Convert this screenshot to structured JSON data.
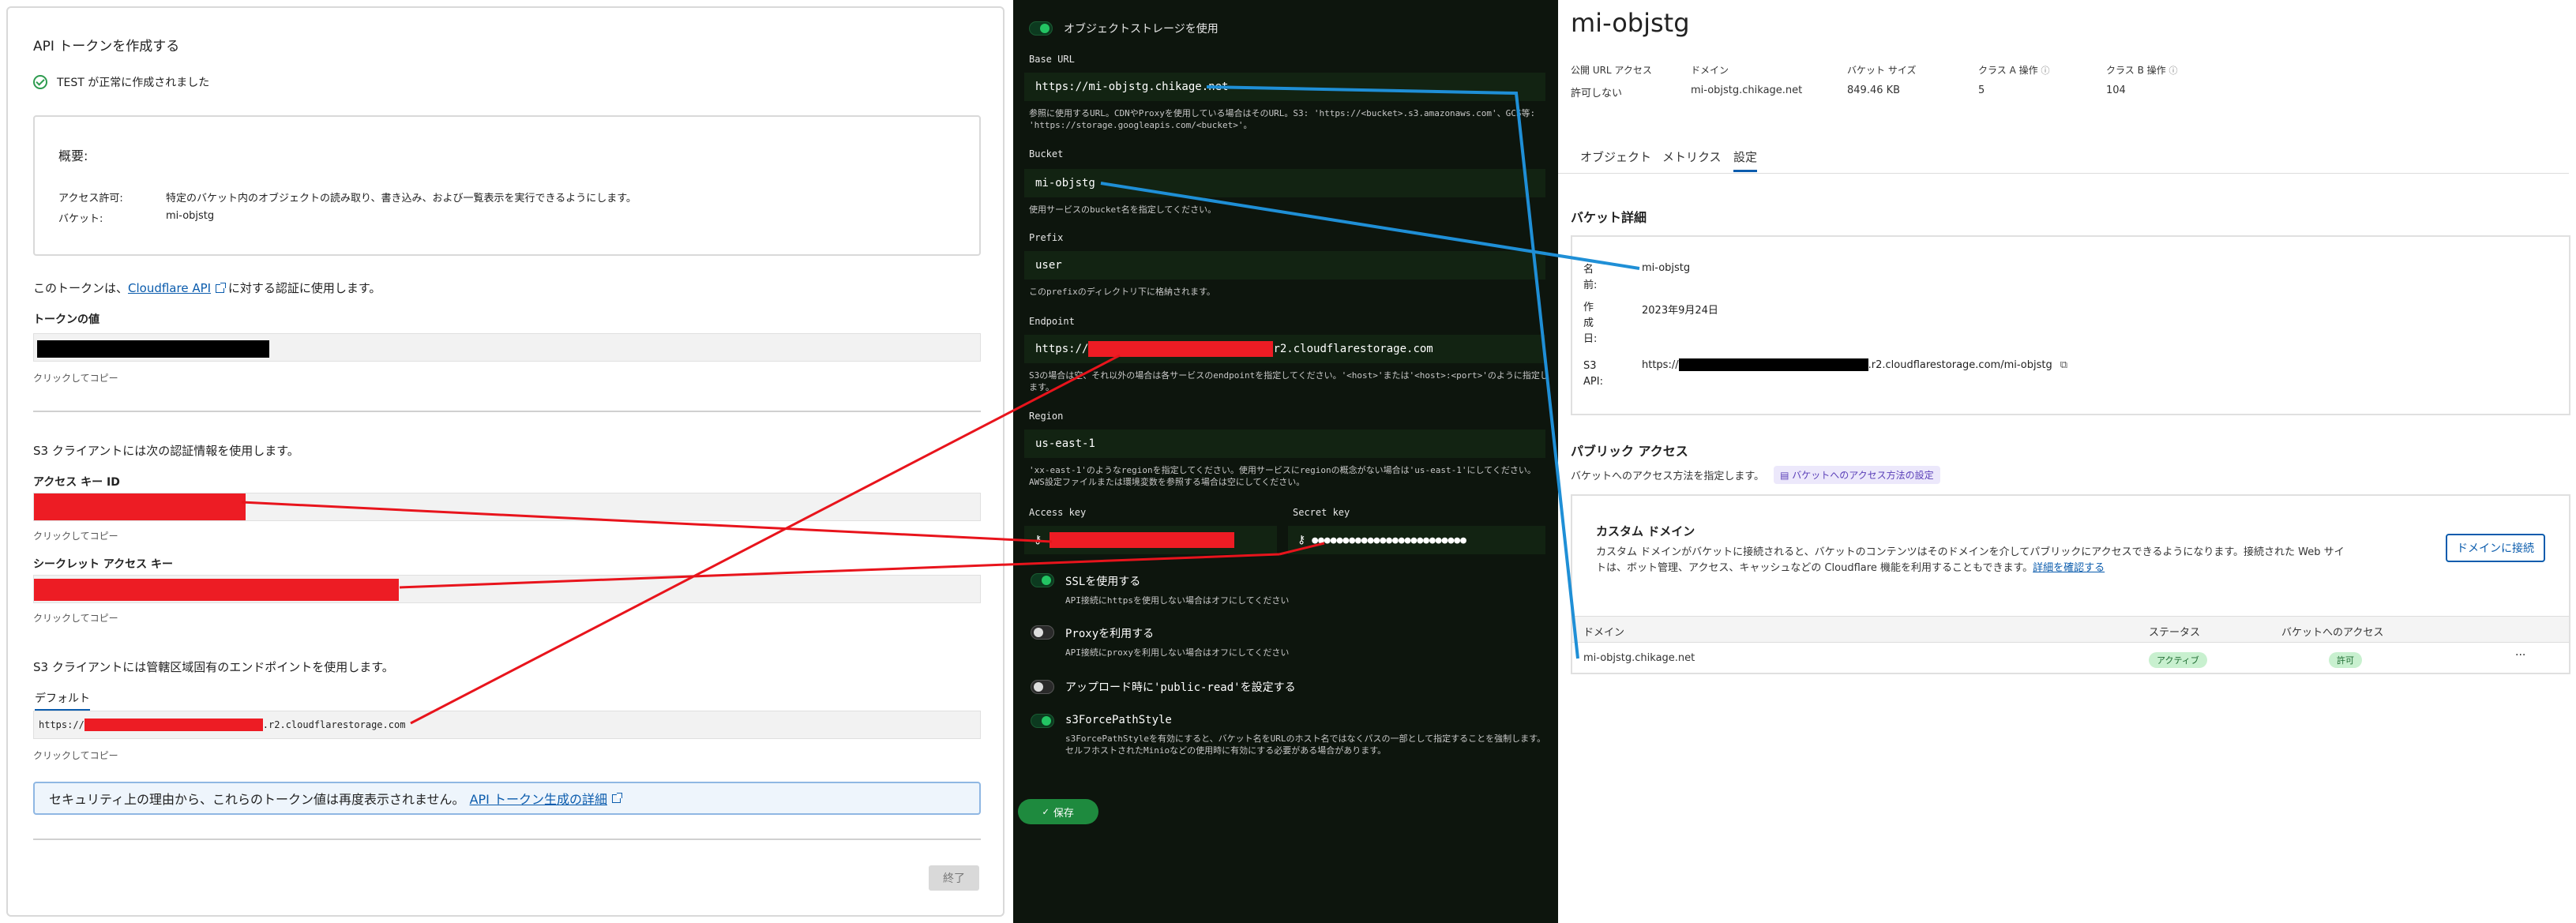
{
  "left": {
    "title": "API トークンを作成する",
    "success_text": "TEST が正常に作成されました",
    "summary_heading": "概要:",
    "permission_key": "アクセス許可:",
    "permission_value": "特定のバケット内のオブジェクトの読み取り、書き込み、および一覧表示を実行できるようにします。",
    "bucket_key": "バケット:",
    "bucket_value": "mi-objstg",
    "token_auth_prefix": "このトークンは、",
    "token_auth_link": "Cloudflare API",
    "token_auth_suffix": " に対する認証に使用します。",
    "token_value_label": "トークンの値",
    "click_to_copy": "クリックしてコピー",
    "s3_auth_text": "S3 クライアントには次の認証情報を使用します。",
    "access_key_label": "アクセス キー ID",
    "secret_key_label": "シークレット アクセス キー",
    "s3_endpoint_text": "S3 クライアントには管轄区域固有のエンドポイントを使用します。",
    "default_tab": "デフォルト",
    "endpoint_prefix": "https://",
    "endpoint_suffix": ".r2.cloudflarestorage.com",
    "security_notice": "セキュリティ上の理由から、これらのトークン値は再度表示されません。",
    "security_link": "API トークン生成の詳細",
    "finish_button": "終了"
  },
  "middle": {
    "object_storage_toggle_label": "オブジェクトストレージを使用",
    "base_url_label": "Base URL",
    "base_url_value": "https://mi-objstg.chikage.net",
    "base_url_help": "参照に使用するURL。CDNやProxyを使用している場合はそのURL。S3: 'https://<bucket>.s3.amazonaws.com'、GCS等: 'https://storage.googleapis.com/<bucket>'。",
    "bucket_label": "Bucket",
    "bucket_value": "mi-objstg",
    "bucket_help": "使用サービスのbucket名を指定してください。",
    "prefix_label": "Prefix",
    "prefix_value": "user",
    "prefix_help": "このprefixのディレクトリ下に格納されます。",
    "endpoint_label": "Endpoint",
    "endpoint_prefix": "https://",
    "endpoint_suffix": "r2.cloudflarestorage.com",
    "endpoint_help": "S3の場合は空、それ以外の場合は各サービスのendpointを指定してください。'<host>'または'<host>:<port>'のように指定します。",
    "region_label": "Region",
    "region_value": "us-east-1",
    "region_help": "'xx-east-1'のようなregionを指定してください。使用サービスにregionの概念がない場合は'us-east-1'にしてください。AWS設定ファイルまたは環境変数を参照する場合は空にしてください。",
    "access_key_label": "Access key",
    "secret_key_label": "Secret key",
    "secret_dots": "●●●●●●●●●●●●●●●●●●●●●●●●●",
    "ssl_title": "SSLを使用する",
    "ssl_help": "API接続にhttpsを使用しない場合はオフにしてください",
    "proxy_title": "Proxyを利用する",
    "proxy_help": "API接続にproxyを利用しない場合はオフにしてください",
    "public_read_title": "アップロード時に'public-read'を設定する",
    "force_path_title": "s3ForcePathStyle",
    "force_path_help": "s3ForcePathStyleを有効にすると、バケット名をURLのホスト名ではなくパスの一部として指定することを強制します。セルフホストされたMinioなどの使用時に有効にする必要がある場合があります。",
    "save_button": "保存"
  },
  "right": {
    "title": "mi-objstg",
    "stats": [
      {
        "key": "公開 URL アクセス",
        "value": "許可しない"
      },
      {
        "key": "ドメイン",
        "value": "mi-objstg.chikage.net"
      },
      {
        "key": "バケット サイズ",
        "value": "849.46 KB"
      },
      {
        "key": "クラス A 操作",
        "value": "5"
      },
      {
        "key": "クラス B 操作",
        "value": "104"
      }
    ],
    "tabs": [
      "オブジェクト",
      "メトリクス",
      "設定"
    ],
    "bucket_details_heading": "バケット詳細",
    "name_key": "名前:",
    "name_value": "mi-objstg",
    "created_key": "作成日:",
    "created_value": "2023年9月24日",
    "s3api_key": "S3 API:",
    "s3api_prefix": "https://",
    "s3api_suffix": ".r2.cloudflarestorage.com/mi-objstg",
    "public_access_heading": "パブリック アクセス",
    "public_access_desc": "バケットへのアクセス方法を指定します。",
    "public_access_pill": "バケットへのアクセス方法の設定",
    "custom_domain_heading": "カスタム ドメイン",
    "custom_domain_desc_1": "カスタム ドメインがバケットに接続されると、バケットのコンテンツはそのドメインを介してパブリックにアクセスできるようになります。接続された Web サイ",
    "custom_domain_desc_2": "トは、ボット管理、アクセス、キャッシュなどの Cloudflare 機能を利用することもできます。",
    "custom_domain_link": "詳細を確認する",
    "connect_domain_button": "ドメインに接続",
    "table_headers": [
      "ドメイン",
      "ステータス",
      "バケットへのアクセス"
    ],
    "row": {
      "domain": "mi-objstg.chikage.net",
      "status": "アクティブ",
      "access": "許可",
      "more": "···"
    }
  },
  "colors": {
    "redact_red": "#ed1c24",
    "arrow_red": "#e8141c",
    "arrow_blue": "#1f8fd6",
    "dark_bg": "#0d150d",
    "green": "#23c463",
    "link_blue": "#0b5cad"
  }
}
